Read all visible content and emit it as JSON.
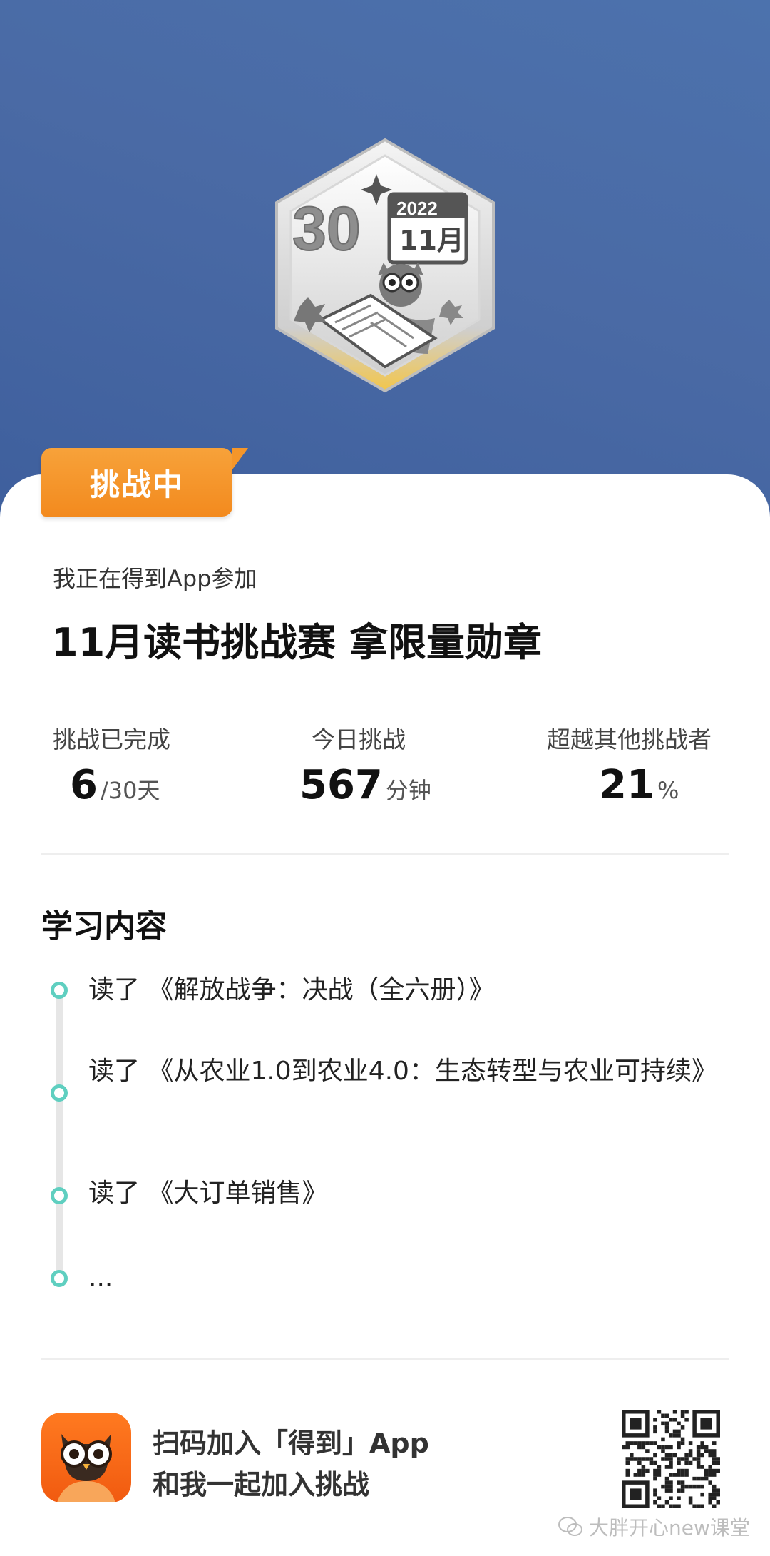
{
  "status_tag": "挑战中",
  "intro": "我正在得到App参加",
  "title": "11月读书挑战赛 拿限量勋章",
  "badge": {
    "number": "30",
    "year": "2022",
    "month": "11月"
  },
  "stats": [
    {
      "label": "挑战已完成",
      "value": "6",
      "unit": "/30天"
    },
    {
      "label": "今日挑战",
      "value": "567",
      "unit": "分钟"
    },
    {
      "label": "超越其他挑战者",
      "value": "21",
      "unit": "%"
    }
  ],
  "section_title": "学习内容",
  "items": [
    {
      "text": "读了 《解放战争：决战（全六册）》"
    },
    {
      "text": "读了 《从农业1.0到农业4.0：生态转型与农业可持续》"
    },
    {
      "text": "读了 《大订单销售》"
    },
    {
      "text": "..."
    }
  ],
  "cta": {
    "line1": "扫码加入「得到」App",
    "line2": "和我一起加入挑战"
  },
  "watermark": "大胖开心new课堂",
  "colors": {
    "hero": "#4a6aa5",
    "tag": "#f38a1e",
    "timeline_dot": "#5fcfc0"
  }
}
